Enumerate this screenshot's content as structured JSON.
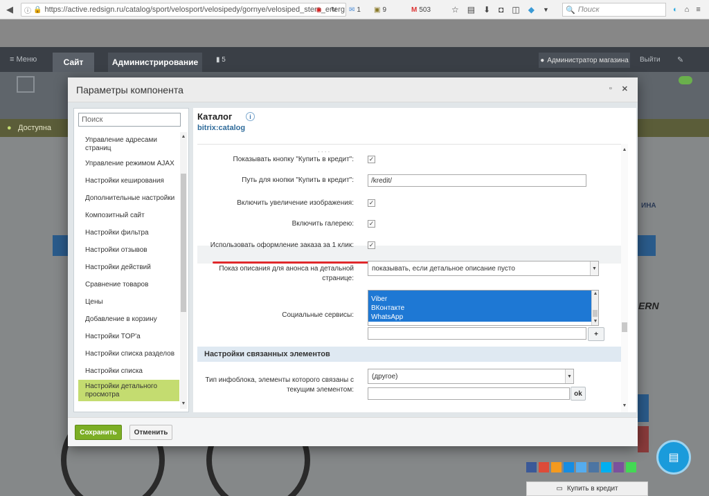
{
  "browser": {
    "url": "https://active.redsign.ru/catalog/sport/velosport/velosipedy/gornye/velosiped_stern_energ",
    "mail_count": "1",
    "box_count": "9",
    "gmail_count": "503",
    "search_placeholder": "Поиск"
  },
  "admin_bar": {
    "menu_label": "Меню",
    "tab_site": "Сайт",
    "tab_admin": "Администрирование",
    "notif_count": "5",
    "user_label": "Администратор магазина",
    "exit_label": "Выйти"
  },
  "background": {
    "access_label": "Доступна",
    "right_text_1": "ИНА",
    "right_text_2": "ERN",
    "credit_button": "Купить в кредит"
  },
  "modal": {
    "title": "Параметры компонента",
    "component_title": "Каталог",
    "component_code": "bitrix:catalog"
  },
  "sidebar": {
    "search_value": "Поиск",
    "items": [
      {
        "label": "Управление адресами страниц"
      },
      {
        "label": "Управление режимом AJAX"
      },
      {
        "label": "Настройки кеширования"
      },
      {
        "label": "Дополнительные настройки"
      },
      {
        "label": "Композитный сайт"
      },
      {
        "label": "Настройки фильтра"
      },
      {
        "label": "Настройки отзывов"
      },
      {
        "label": "Настройки действий"
      },
      {
        "label": "Сравнение товаров"
      },
      {
        "label": "Цены"
      },
      {
        "label": "Добавление в корзину"
      },
      {
        "label": "Настройки TOP'а"
      },
      {
        "label": "Настройки списка разделов"
      },
      {
        "label": "Настройки списка"
      },
      {
        "label": "Настройки детального просмотра"
      }
    ]
  },
  "params": {
    "credit_btn_label": "Показывать кнопку \"Купить в кредит\":",
    "credit_path_label": "Путь для кнопки \"Купить в кредит\":",
    "credit_path_value": "/kredit/",
    "zoom_label": "Включить увеличение изображения:",
    "gallery_label": "Включить галерею:",
    "one_click_label": "Использовать оформление заказа за 1 клик:",
    "anons_label": "Показ описания для анонса на детальной странице:",
    "anons_value": "показывать, если детальное описание пусто",
    "social_label": "Социальные сервисы:",
    "social_options": [
      "Viber",
      "ВКонтакте",
      "WhatsApp"
    ],
    "social_add": "+",
    "section_linked": "Настройки связанных элементов",
    "iblock_label": "Тип инфоблока, элементы которого связаны с текущим элементом:",
    "iblock_value": "(другое)",
    "ok_label": "ok"
  },
  "footer": {
    "save_label": "Сохранить",
    "cancel_label": "Отменить"
  }
}
